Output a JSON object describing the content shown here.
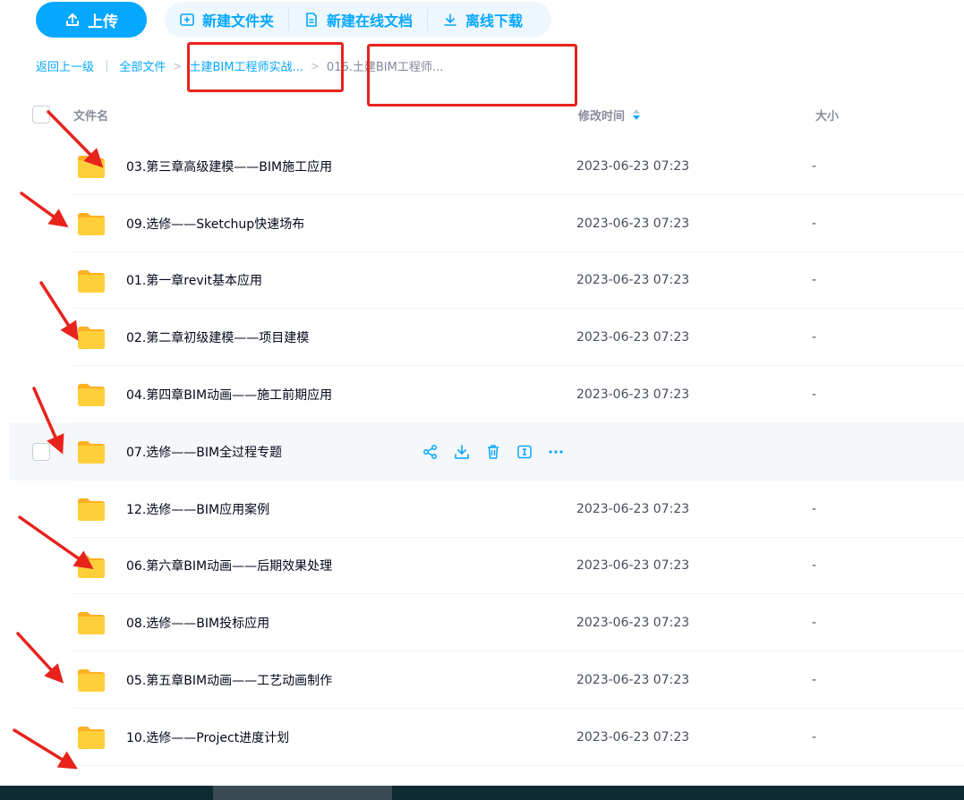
{
  "toolbar": {
    "upload_label": "上传",
    "new_folder_label": "新建文件夹",
    "new_doc_label": "新建在线文档",
    "offline_download_label": "离线下载"
  },
  "breadcrumb": {
    "back_label": "返回上一级",
    "separator": "|",
    "all_files_label": "全部文件",
    "chevron": ">",
    "level1_label": "土建BIM工程师实战...",
    "level2_label": "016.土建BIM工程师..."
  },
  "table": {
    "col_name": "文件名",
    "col_time": "修改时间",
    "col_size": "大小",
    "rows": [
      {
        "name": "03.第三章高级建模——BIM施工应用",
        "time": "2023-06-23 07:23",
        "size": "-"
      },
      {
        "name": "09.选修——Sketchup快速场布",
        "time": "2023-06-23 07:23",
        "size": "-"
      },
      {
        "name": "01.第一章revit基本应用",
        "time": "2023-06-23 07:23",
        "size": "-"
      },
      {
        "name": "02.第二章初级建模——项目建模",
        "time": "2023-06-23 07:23",
        "size": "-"
      },
      {
        "name": "04.第四章BIM动画——施工前期应用",
        "time": "2023-06-23 07:23",
        "size": "-"
      },
      {
        "name": "07.选修——BIM全过程专题",
        "time": "",
        "size": ""
      },
      {
        "name": "12.选修——BIM应用案例",
        "time": "2023-06-23 07:23",
        "size": "-"
      },
      {
        "name": "06.第六章BIM动画——后期效果处理",
        "time": "2023-06-23 07:23",
        "size": "-"
      },
      {
        "name": "08.选修——BIM投标应用",
        "time": "2023-06-23 07:23",
        "size": "-"
      },
      {
        "name": "05.第五章BIM动画——工艺动画制作",
        "time": "2023-06-23 07:23",
        "size": "-"
      },
      {
        "name": "10.选修——Project进度计划",
        "time": "2023-06-23 07:23",
        "size": "-"
      }
    ]
  },
  "colors": {
    "accent": "#06a7ff",
    "annotation_red": "#e8231c",
    "folder_yellow": "#ffc933"
  }
}
